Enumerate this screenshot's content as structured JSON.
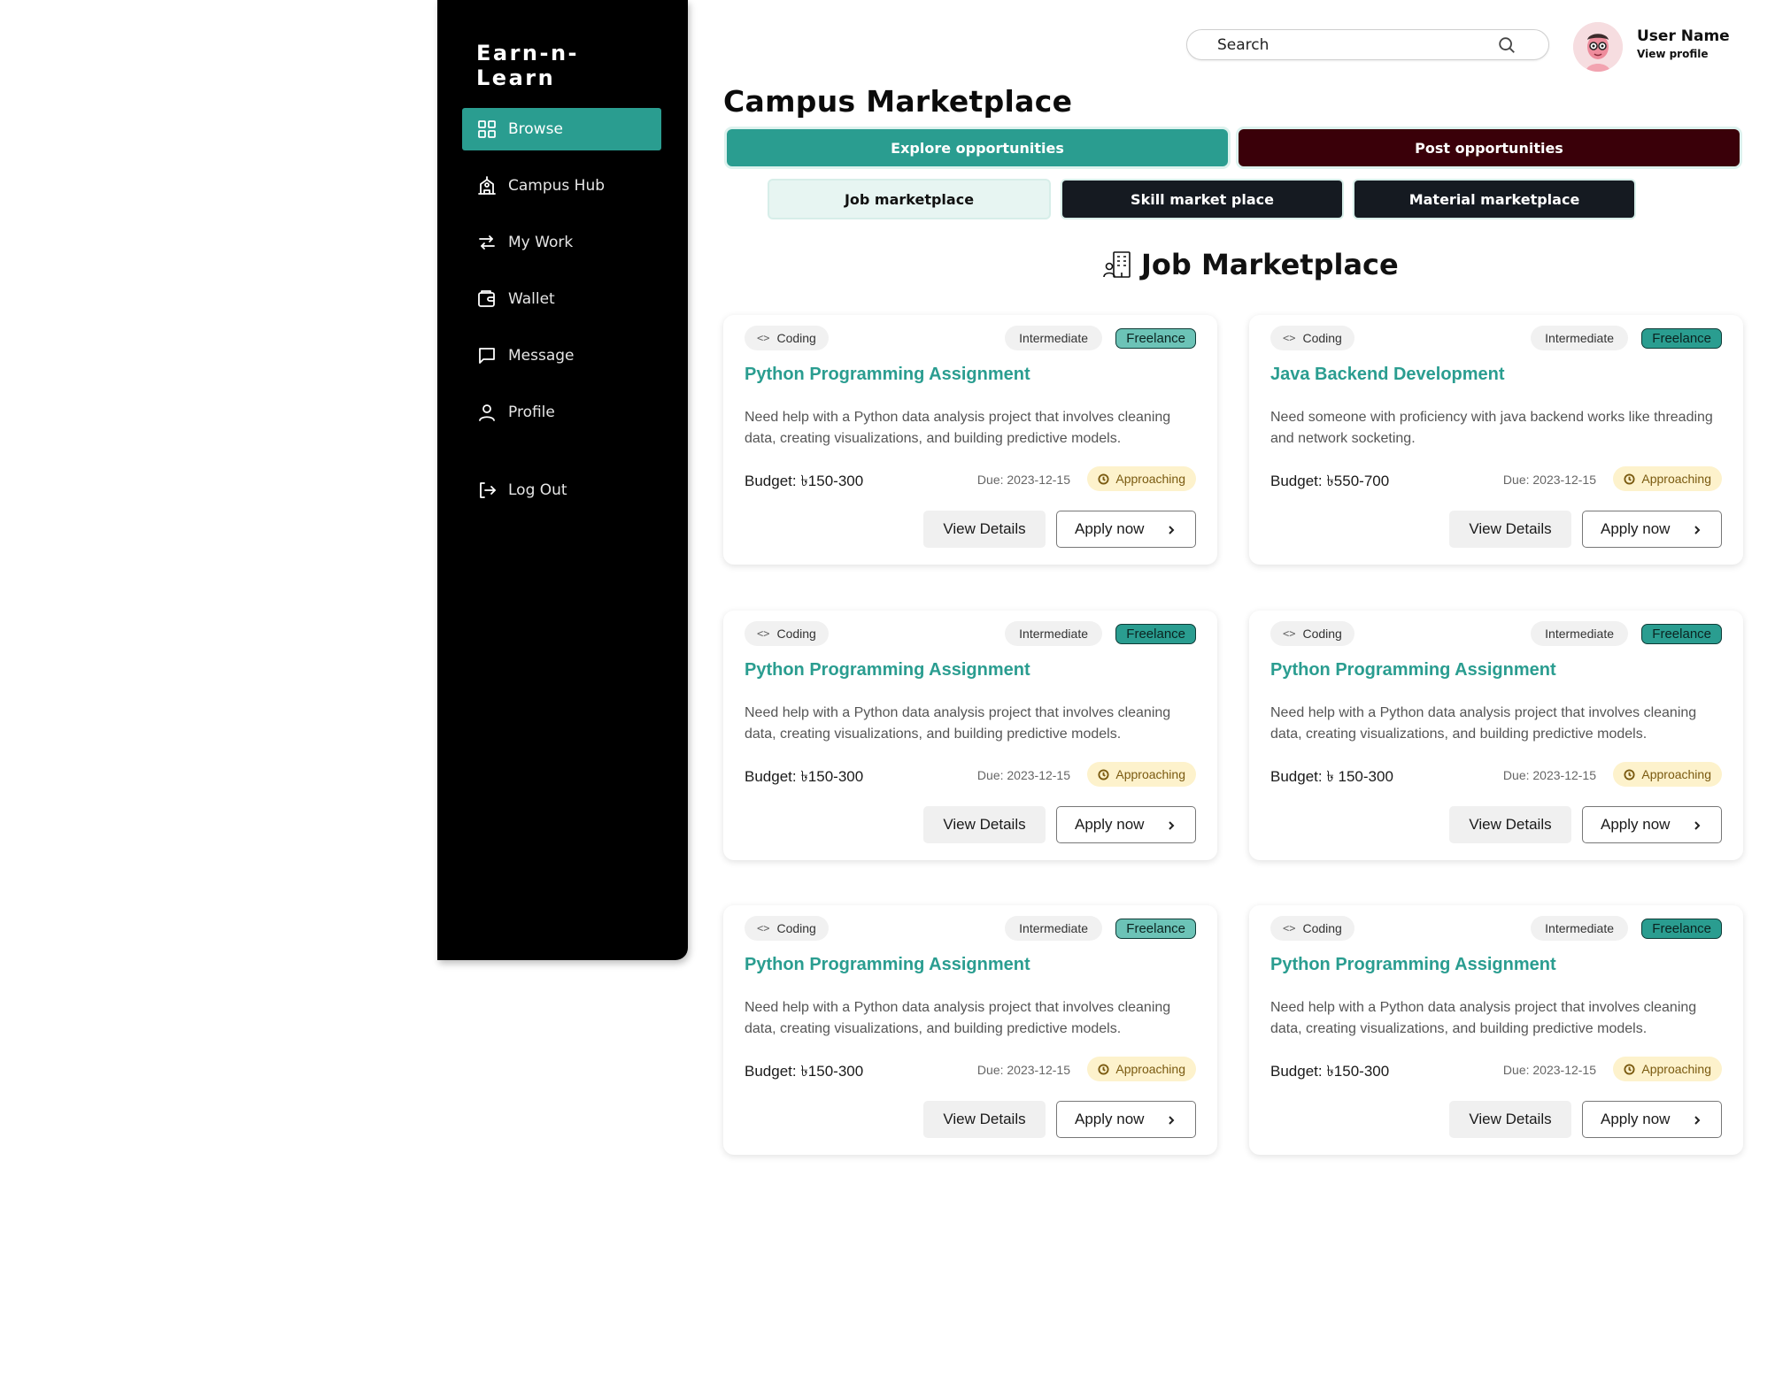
{
  "app": {
    "brand": "Earn-n-Learn"
  },
  "sidebar": {
    "items": [
      {
        "label": "Browse",
        "icon": "grid-icon",
        "active": true
      },
      {
        "label": "Campus Hub",
        "icon": "building-icon"
      },
      {
        "label": "My Work",
        "icon": "swap-arrows-icon"
      },
      {
        "label": "Wallet",
        "icon": "wallet-icon"
      },
      {
        "label": "Message",
        "icon": "message-icon"
      },
      {
        "label": "Profile",
        "icon": "user-icon"
      },
      {
        "label": "Log Out",
        "icon": "logout-icon"
      }
    ]
  },
  "header": {
    "search_placeholder": "Search",
    "user_name": "User Name",
    "view_profile": "View profile"
  },
  "page": {
    "title": "Campus Marketplace",
    "main_tabs": [
      "Explore opportunities",
      "Post opportunities"
    ],
    "sub_tabs": [
      "Job marketplace",
      "Skill market place",
      "Material marketplace"
    ],
    "section_title": "Job Marketplace"
  },
  "colors": {
    "accent": "#2a9d90",
    "post_tab": "#3a0009",
    "dark_tab": "#151a21",
    "status_bg": "#fdf2cc"
  },
  "cards": [
    {
      "category": "Coding",
      "level": "Intermediate",
      "type": "Freelance",
      "title": "Python Programming Assignment",
      "description": "Need help with a Python data analysis project that involves cleaning data, creating visualizations, and building predictive models.",
      "budget": "Budget: ৳150-300",
      "due": "Due: 2023-12-15",
      "status": "Approaching",
      "view_label": "View Details",
      "apply_label": "Apply now"
    },
    {
      "category": "Coding",
      "level": "Intermediate",
      "type": "Freelance",
      "title": "Java Backend Development",
      "description": "Need someone with proficiency with java backend works like threading and network socketing.",
      "budget": "Budget: ৳550-700",
      "due": "Due: 2023-12-15",
      "status": "Approaching",
      "view_label": "View Details",
      "apply_label": "Apply now"
    },
    {
      "category": "Coding",
      "level": "Intermediate",
      "type": "Freelance",
      "title": "Python Programming Assignment",
      "description": "Need help with a Python data analysis project that involves cleaning data, creating visualizations, and building predictive models.",
      "budget": "Budget: ৳150-300",
      "due": "Due: 2023-12-15",
      "status": "Approaching",
      "view_label": "View Details",
      "apply_label": "Apply now"
    },
    {
      "category": "Coding",
      "level": "Intermediate",
      "type": "Freelance",
      "title": "Python Programming Assignment",
      "description": "Need help with a Python data analysis project that involves cleaning data, creating visualizations, and building predictive models.",
      "budget": "Budget: ৳ 150-300",
      "due": "Due: 2023-12-15",
      "status": "Approaching",
      "view_label": "View Details",
      "apply_label": "Apply now"
    },
    {
      "category": "Coding",
      "level": "Intermediate",
      "type": "Freelance",
      "title": "Python Programming Assignment",
      "description": "Need help with a Python data analysis project that involves cleaning data, creating visualizations, and building predictive models.",
      "budget": "Budget: ৳150-300",
      "due": "Due: 2023-12-15",
      "status": "Approaching",
      "view_label": "View Details",
      "apply_label": "Apply now"
    },
    {
      "category": "Coding",
      "level": "Intermediate",
      "type": "Freelance",
      "title": "Python Programming Assignment",
      "description": "Need help with a Python data analysis project that involves cleaning data, creating visualizations, and building predictive models.",
      "budget": "Budget: ৳150-300",
      "due": "Due: 2023-12-15",
      "status": "Approaching",
      "view_label": "View Details",
      "apply_label": "Apply now"
    }
  ]
}
